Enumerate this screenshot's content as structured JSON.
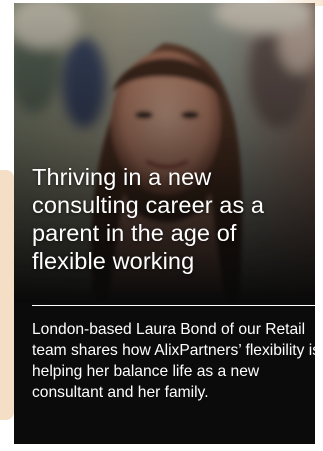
{
  "card": {
    "photo_icon": "portrait-photo",
    "headline": "Thriving in a new consulting career as a parent in the age of flexible working",
    "summary": "London-based Laura Bond of our Retail team shares how AlixPartners’ flexibility is helping her balance life as a new consultant and her family."
  },
  "colors": {
    "card_background": "#0b0b0b",
    "text": "#ffffff",
    "decor_accent": "#f4dfc6"
  }
}
